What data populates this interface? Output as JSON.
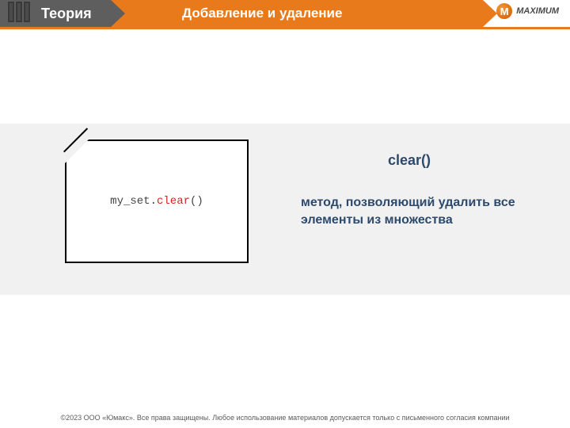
{
  "header": {
    "section": "Теория",
    "title": "Добавление и удаление"
  },
  "logo": {
    "mark": "M",
    "name": "MAXIMUM",
    "sub": ""
  },
  "code": {
    "object": "my_set",
    "dot": ".",
    "method": "clear",
    "parens": "()"
  },
  "desc": {
    "title": "clear()",
    "body": "метод, позволяющий удалить все элементы из множества"
  },
  "footer": {
    "text": "©2023 ООО «Юмакс». Все права защищены. Любое использование материалов допускается только с письменного согласия компании"
  }
}
